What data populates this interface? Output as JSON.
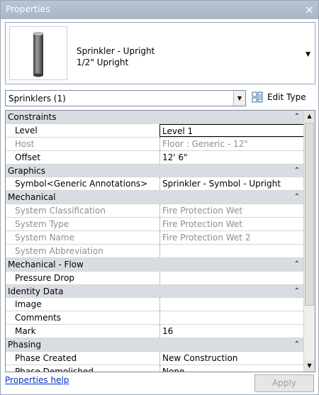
{
  "window": {
    "title": "Properties",
    "close_glyph": "×"
  },
  "type_selector": {
    "family": "Sprinkler - Upright",
    "type": "1/2\" Upright",
    "thumbnail_icon": "sprinkler-cylinder-icon",
    "dropdown_glyph": "▼"
  },
  "instance_filter": {
    "value": "Sprinklers (1)",
    "dropdown_glyph": "▼"
  },
  "edit_type": {
    "label": "Edit Type",
    "icon": "edit-type-icon"
  },
  "property_groups": [
    {
      "name": "Constraints",
      "collapse_glyph": "⌃",
      "rows": [
        {
          "name": "Level",
          "value": "Level 1",
          "readonly": false,
          "active": true
        },
        {
          "name": "Host",
          "value": "Floor : Generic - 12\"",
          "readonly": true
        },
        {
          "name": "Offset",
          "value": "12'  6\"",
          "readonly": false
        }
      ]
    },
    {
      "name": "Graphics",
      "collapse_glyph": "⌃",
      "rows": [
        {
          "name": "Symbol<Generic Annotations>",
          "value": "Sprinkler - Symbol - Upright",
          "readonly": false
        }
      ]
    },
    {
      "name": "Mechanical",
      "collapse_glyph": "⌃",
      "rows": [
        {
          "name": "System Classification",
          "value": "Fire Protection Wet",
          "readonly": true
        },
        {
          "name": "System Type",
          "value": "Fire Protection Wet",
          "readonly": true
        },
        {
          "name": "System Name",
          "value": "Fire Protection Wet 2",
          "readonly": true
        },
        {
          "name": "System Abbreviation",
          "value": "",
          "readonly": true
        }
      ]
    },
    {
      "name": "Mechanical - Flow",
      "collapse_glyph": "⌃",
      "rows": [
        {
          "name": "Pressure Drop",
          "value": "",
          "readonly": false
        }
      ]
    },
    {
      "name": "Identity Data",
      "collapse_glyph": "⌃",
      "rows": [
        {
          "name": "Image",
          "value": "",
          "readonly": false
        },
        {
          "name": "Comments",
          "value": "",
          "readonly": false
        },
        {
          "name": "Mark",
          "value": "16",
          "readonly": false
        }
      ]
    },
    {
      "name": "Phasing",
      "collapse_glyph": "⌃",
      "rows": [
        {
          "name": "Phase Created",
          "value": "New Construction",
          "readonly": false
        },
        {
          "name": "Phase Demolished",
          "value": "None",
          "readonly": false
        }
      ]
    }
  ],
  "scrollbar": {
    "up_glyph": "▲",
    "down_glyph": "▼"
  },
  "footer": {
    "help_link": "Properties help",
    "apply_label": "Apply"
  },
  "colors": {
    "group_header_bg": "#d9dde3",
    "readonly_text": "#8e8e8e",
    "link": "#0033cc",
    "titlebar": "#b9c4d4"
  }
}
